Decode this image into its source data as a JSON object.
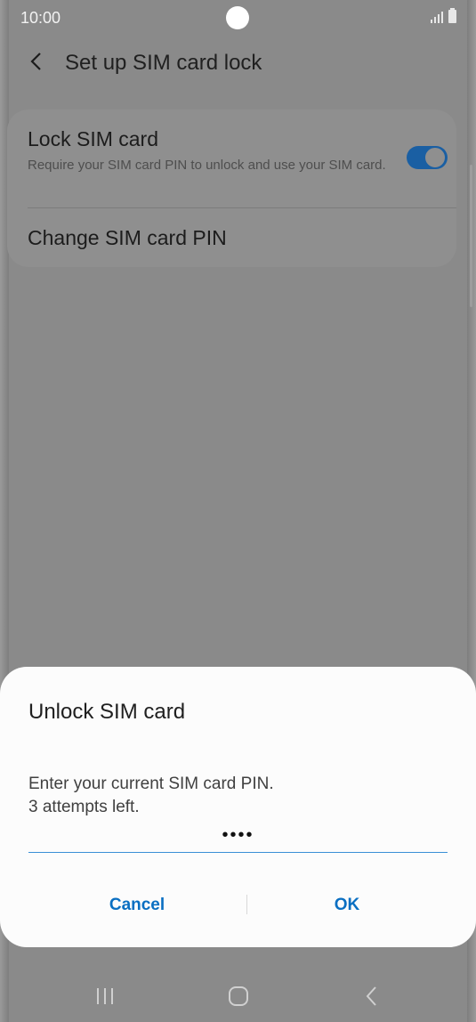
{
  "status_bar": {
    "time": "10:00"
  },
  "header": {
    "title": "Set up SIM card lock",
    "back_icon": "chevron-left-icon"
  },
  "settings": {
    "lock_sim": {
      "title": "Lock SIM card",
      "subtitle": "Require your SIM card PIN to unlock and use your SIM card.",
      "toggle_on": true
    },
    "change_pin": {
      "title": "Change SIM card PIN"
    }
  },
  "dialog": {
    "title": "Unlock SIM card",
    "message_line1": "Enter your current SIM card PIN.",
    "message_line2": "3 attempts left.",
    "pin_value": "••••",
    "cancel_label": "Cancel",
    "ok_label": "OK"
  },
  "colors": {
    "accent": "#0a6fc2",
    "toggle": "#1a5fa3",
    "scrim": "#8a8a8a"
  },
  "nav_bar": {
    "icons": [
      "recent-apps-icon",
      "home-icon",
      "back-icon"
    ]
  }
}
